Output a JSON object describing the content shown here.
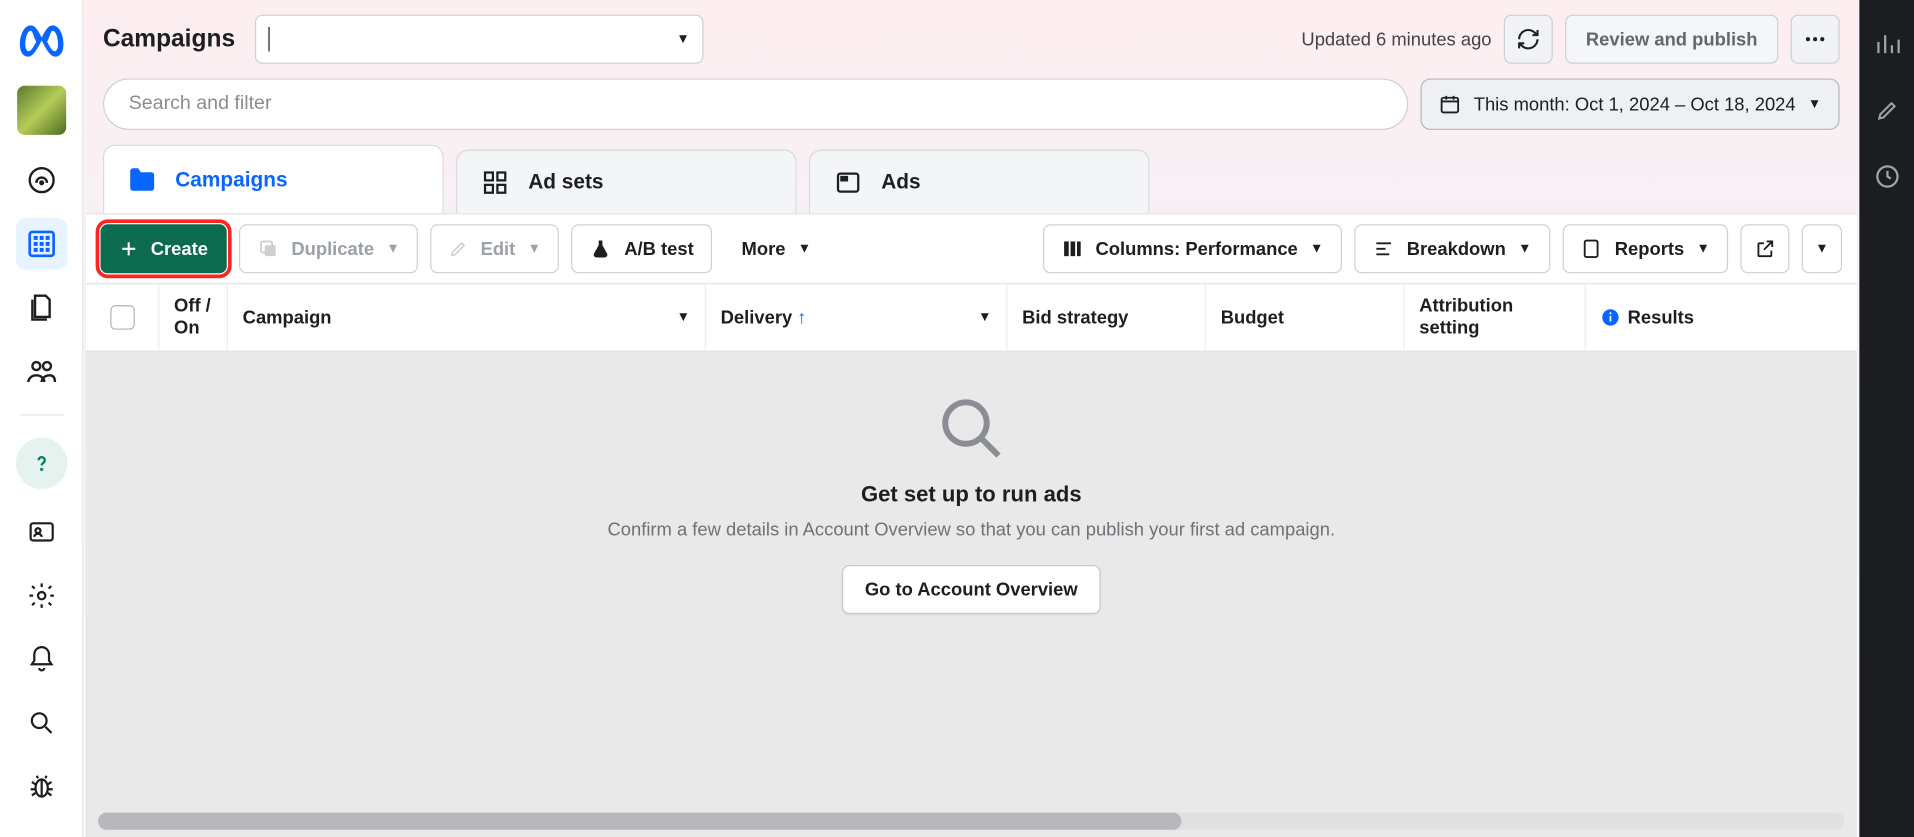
{
  "header": {
    "title": "Campaigns",
    "updated_text": "Updated 6 minutes ago",
    "review_label": "Review and publish"
  },
  "search": {
    "placeholder": "Search and filter"
  },
  "date_range": {
    "label": "This month: Oct 1, 2024 – Oct 18, 2024"
  },
  "tabs": {
    "campaigns": "Campaigns",
    "adsets": "Ad sets",
    "ads": "Ads"
  },
  "toolbar": {
    "create": "Create",
    "duplicate": "Duplicate",
    "edit": "Edit",
    "ab_test": "A/B test",
    "more": "More",
    "columns": "Columns: Performance",
    "breakdown": "Breakdown",
    "reports": "Reports"
  },
  "columns": {
    "off_on": "Off / On",
    "campaign": "Campaign",
    "delivery": "Delivery",
    "bid_strategy": "Bid strategy",
    "budget": "Budget",
    "attribution": "Attribution setting",
    "results": "Results"
  },
  "empty": {
    "title": "Get set up to run ads",
    "subtitle": "Confirm a few details in Account Overview so that you can publish your first ad campaign.",
    "button": "Go to Account Overview"
  }
}
